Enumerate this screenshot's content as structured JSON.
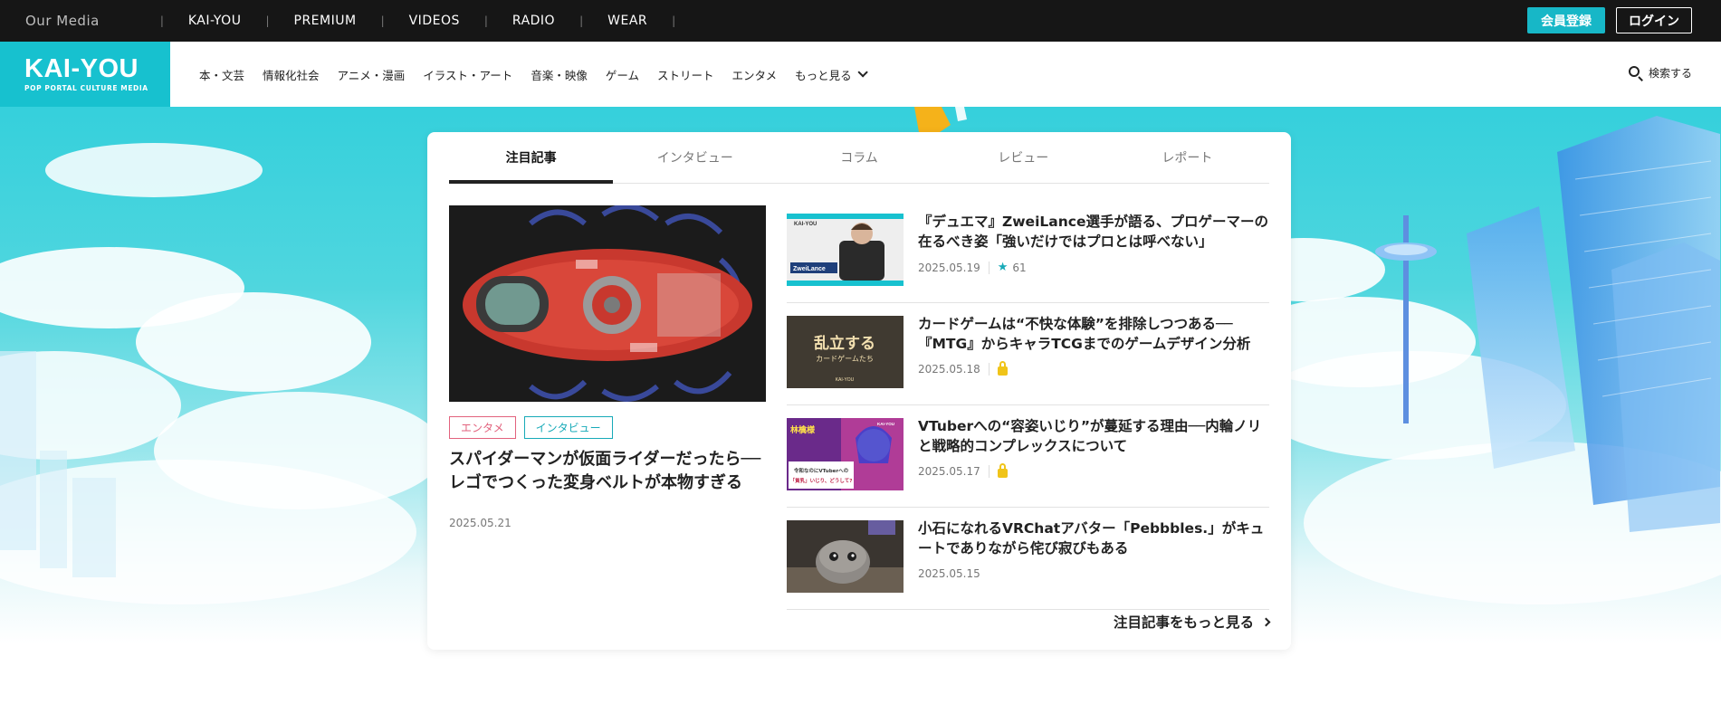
{
  "topbar": {
    "media_label": "Our Media",
    "links": [
      "KAI-YOU",
      "PREMIUM",
      "VIDEOS",
      "RADIO",
      "WEAR"
    ],
    "register_label": "会員登録",
    "login_label": "ログイン"
  },
  "header": {
    "logo_main": "KAI-YOU",
    "logo_sub": "POP PORTAL CULTURE MEDIA",
    "nav": [
      "本・文芸",
      "情報化社会",
      "アニメ・漫画",
      "イラスト・アート",
      "音楽・映像",
      "ゲーム",
      "ストリート",
      "エンタメ"
    ],
    "more_label": "もっと見る",
    "search_label": "検索する"
  },
  "tabs": [
    "注目記事",
    "インタビュー",
    "コラム",
    "レビュー",
    "レポート"
  ],
  "featured": {
    "tags": [
      "エンタメ",
      "インタビュー"
    ],
    "title": "スパイダーマンが仮面ライダーだったら──レゴでつくった変身ベルトが本物すぎる",
    "date": "2025.05.21"
  },
  "articles": [
    {
      "title": "『デュエマ』ZweiLance選手が語る、プロゲーマーの在るべき姿「強いだけではプロとは呼べない」",
      "date": "2025.05.19",
      "likes": "61",
      "thumb_logo": "KAI-YOU",
      "thumb_name": "ZweiLance"
    },
    {
      "title": "カードゲームは“不快な体験”を排除しつつある──『MTG』からキャラTCGまでのゲームデザイン分析",
      "date": "2025.05.18",
      "thumb_main": "乱立する",
      "thumb_sub": "カードゲームたち",
      "thumb_logo": "KAI-YOU"
    },
    {
      "title": "VTuberへの“容姿いじり”が蔓延する理由──内輪ノリと戦略的コンプレックスについて",
      "date": "2025.05.17",
      "thumb_main": "令和なのにVTuberへの",
      "thumb_sub": "「貧乳」いじり、どうして?",
      "thumb_side": "林檎様",
      "thumb_logo": "KAI-YOU"
    },
    {
      "title": "小石になれるVRChatアバター「Pebbbles.」がキュートでありながら侘び寂びもある",
      "date": "2025.05.15"
    }
  ],
  "more_link": "注目記事をもっと見る",
  "colors": {
    "accent": "#17c1cf",
    "tag_pink": "#e2627d",
    "tag_teal": "#17aab8",
    "lock": "#f0c419"
  }
}
